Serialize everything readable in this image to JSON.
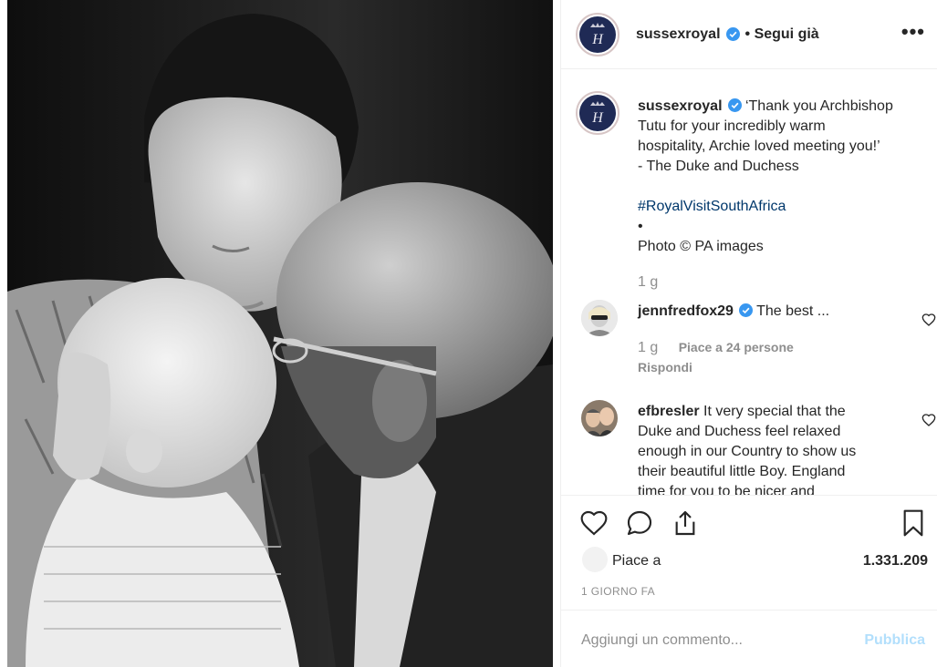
{
  "header": {
    "username": "sussexroyal",
    "follow_label": "• Segui già",
    "more_label": "•••"
  },
  "caption": {
    "username": "sussexroyal",
    "lines": [
      "‘Thank you Archbishop",
      "Tutu for your incredibly warm",
      "hospitality, Archie loved meeting you!’",
      "- The Duke and Duchess"
    ],
    "hashtag": "#RoyalVisitSouthAfrica",
    "bullet": "•",
    "credit": "Photo © PA images",
    "time": "1 g"
  },
  "comments": [
    {
      "username": "jennfredfox29",
      "text": "The best ...",
      "time": "1 g",
      "likes": "Piace a 24 persone",
      "reply": "Rispondi"
    },
    {
      "username": "efbresler",
      "lines": [
        "It very special that the",
        "Duke and Duchess feel relaxed",
        "enough in our Country to show us",
        "their beautiful little Boy. England",
        "time for you to be nicer and"
      ]
    }
  ],
  "likes": {
    "label": "Piace a",
    "count": "1.331.209"
  },
  "posted": "1 GIORNO FA",
  "add_comment": {
    "placeholder": "Aggiungi un commento...",
    "publish": "Pubblica"
  },
  "colors": {
    "verified": "#3897f0",
    "hashtag": "#00376b",
    "publish_disabled": "#b2dffc",
    "crest_bg": "#1f2a55"
  }
}
